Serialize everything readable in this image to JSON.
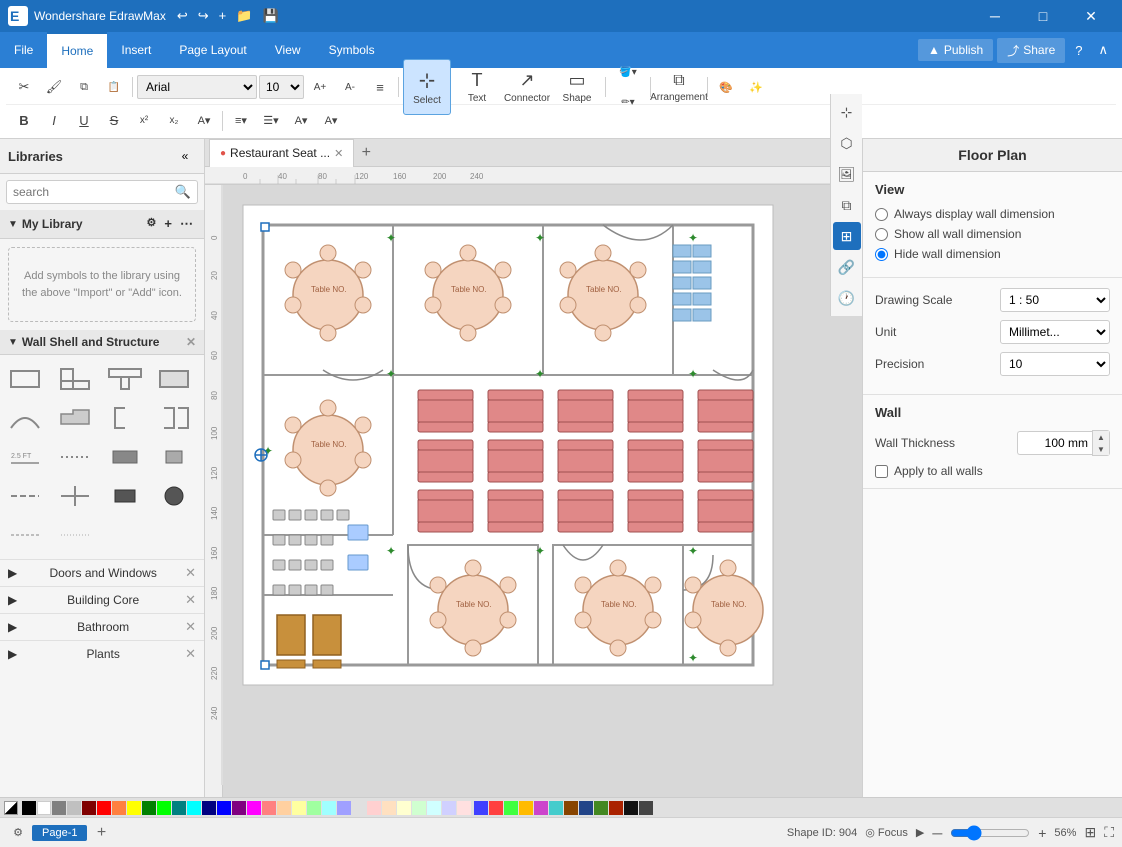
{
  "app": {
    "title": "Wondershare EdrawMax",
    "document": "Restaurant Seat ...",
    "tab_dot_color": "#e0534a"
  },
  "title_bar": {
    "app_name": "Wondershare EdrawMax",
    "buttons": [
      "─",
      "□",
      "✕"
    ]
  },
  "menu": {
    "items": [
      "File",
      "Home",
      "Insert",
      "Page Layout",
      "View",
      "Symbols"
    ],
    "active": "Home",
    "right": [
      "Publish",
      "Share",
      "?",
      "∧"
    ]
  },
  "toolbar": {
    "font_family": "Arial",
    "font_size": "10",
    "format_buttons": [
      "B",
      "I",
      "U",
      "S",
      "x²",
      "x₂",
      "A▾",
      "≡▾",
      "☰▾",
      "A▾",
      "A▾"
    ],
    "big_buttons": [
      {
        "label": "Select",
        "icon": "⊹"
      },
      {
        "label": "Text",
        "icon": "T"
      },
      {
        "label": "Connector",
        "icon": "↗"
      },
      {
        "label": "Shape",
        "icon": "□"
      }
    ],
    "arrangement_label": "Arrangement",
    "publish_label": "Publish",
    "share_label": "Share"
  },
  "sidebar": {
    "title": "Libraries",
    "search_placeholder": "search",
    "collapse_icon": "«",
    "my_library": {
      "title": "My Library",
      "placeholder_text": "Add symbols to the library using the above \"Import\" or \"Add\" icon."
    },
    "shape_library": {
      "title": "Wall Shell and Structure",
      "close_icon": "✕"
    },
    "categories": [
      {
        "name": "Doors and Windows",
        "close": true
      },
      {
        "name": "Building Core",
        "close": true
      },
      {
        "name": "Bathroom",
        "close": true
      },
      {
        "name": "Plants",
        "close": true
      }
    ]
  },
  "canvas": {
    "tabs": [
      {
        "label": "Restaurant Seat ...",
        "active": true,
        "dot": true
      }
    ],
    "add_tab": "+",
    "page_tabs": [
      {
        "label": "Page-1",
        "active": true
      }
    ],
    "add_page": "+"
  },
  "right_panel": {
    "title": "Floor Plan",
    "sections": {
      "view": {
        "title": "View",
        "options": [
          {
            "label": "Always display wall dimension",
            "checked": false
          },
          {
            "label": "Show all wall dimension",
            "checked": false
          },
          {
            "label": "Hide wall dimension",
            "checked": true
          }
        ]
      },
      "drawing": {
        "drawing_scale_label": "Drawing Scale",
        "drawing_scale_value": "1 : 50",
        "unit_label": "Unit",
        "unit_value": "Millimet...",
        "precision_label": "Precision",
        "precision_value": "10"
      },
      "wall": {
        "title": "Wall",
        "wall_thickness_label": "Wall Thickness",
        "wall_thickness_value": "100 mm",
        "apply_label": "Apply to all walls"
      }
    }
  },
  "status_bar": {
    "shape_id_label": "Shape ID: 904",
    "focus_label": "Focus",
    "zoom_percent": "56%",
    "play_icon": "▶",
    "zoom_in": "+",
    "zoom_out": "─",
    "fit_icon": "⊞",
    "fullscreen": "⛶"
  },
  "colors": {
    "accent_blue": "#1e6fbd",
    "toolbar_bg": "#2b7fd4",
    "active_tool_bg": "#cce4ff"
  },
  "shapes": {
    "wall_shapes": [
      "rect_wall",
      "l_wall",
      "t_wall",
      "rect_outline",
      "arc",
      "step",
      "bracket_l",
      "bracket_r",
      "line_h",
      "dot",
      "rect_solid",
      "rect_med",
      "line_dotted",
      "cross",
      "sq_solid",
      "circ_solid",
      "dash_line",
      "dash_line2"
    ]
  },
  "swatches": [
    "#000000",
    "#ffffff",
    "#808080",
    "#c0c0c0",
    "#800000",
    "#ff0000",
    "#ff8040",
    "#ffff00",
    "#008000",
    "#00ff00",
    "#008080",
    "#00ffff",
    "#000080",
    "#0000ff",
    "#800080",
    "#ff00ff",
    "#ff8080",
    "#ffd0a0",
    "#ffffa0",
    "#a0ffa0",
    "#a0ffff",
    "#a0a0ff",
    "#e0e0e0",
    "#ffd0d0",
    "#ffe0c0",
    "#ffffd0",
    "#d0ffd0",
    "#d0ffff",
    "#d0d0ff",
    "#ffe0e0"
  ]
}
